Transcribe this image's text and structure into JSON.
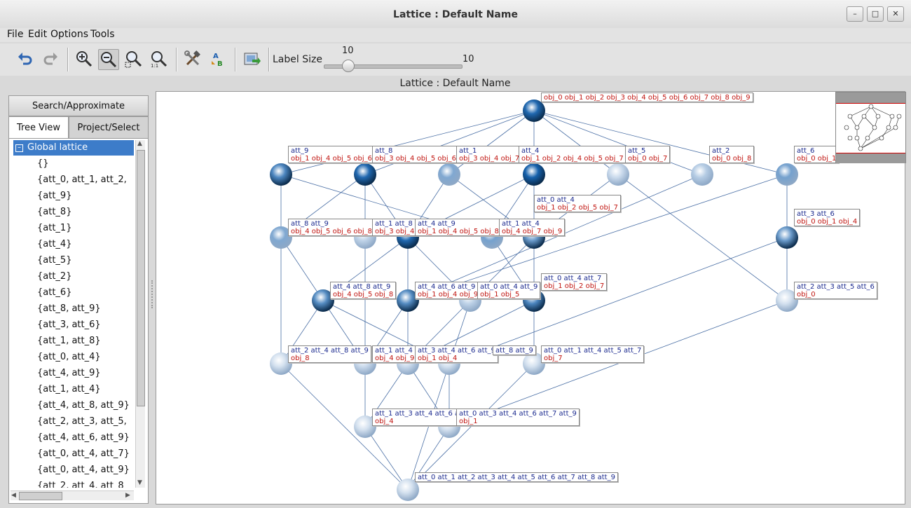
{
  "window": {
    "title": "Lattice : Default Name"
  },
  "menu": [
    "File",
    "Edit",
    "Options",
    "Tools"
  ],
  "toolbar": {
    "icons": [
      "undo-icon",
      "redo-icon",
      "zoom-in-icon",
      "zoom-out-icon",
      "zoom-fit-icon",
      "zoom-reset-icon",
      "settings-tools-icon",
      "label-ab-icon",
      "export-image-icon"
    ],
    "label_size_label": "Label Size",
    "slider_value": "10",
    "slider_max": "10"
  },
  "canvas_caption": "Lattice : Default Name",
  "left_panel": {
    "search_button": "Search/Approximate",
    "tabs": [
      "Tree View",
      "Project/Select"
    ],
    "tree_root": "Global lattice",
    "tree_items": [
      "{}",
      "{att_0, att_1, att_2,",
      "{att_9}",
      "{att_8}",
      "{att_1}",
      "{att_4}",
      "{att_5}",
      "{att_2}",
      "{att_6}",
      "{att_8, att_9}",
      "{att_3, att_6}",
      "{att_1, att_8}",
      "{att_0, att_4}",
      "{att_4, att_9}",
      "{att_1, att_4}",
      "{att_4, att_8, att_9}",
      "{att_2, att_3, att_5,",
      "{att_4, att_6, att_9}",
      "{att_0, att_4, att_7}",
      "{att_0, att_4, att_9}",
      "{att_2, att_4, att_8"
    ]
  },
  "lattice": {
    "colors": {
      "edge": "#4a6fa5",
      "attr_text": "#1b2a8f",
      "obj_text": "#c0140f",
      "node_dark": "#0b5aa8",
      "node_light": "#dfe8f3"
    },
    "labels": [
      {
        "attr": "",
        "obj": "obj_0 obj_1 obj_2 obj_3 obj_4 obj_5 obj_6 obj_7 obj_8 obj_9"
      },
      {
        "attr": "att_9",
        "obj": "obj_1 obj_4 obj_5 obj_6"
      },
      {
        "attr": "att_8",
        "obj": "obj_3 obj_4 obj_5 obj_6"
      },
      {
        "attr": "att_1",
        "obj": "obj_3 obj_4 obj_7"
      },
      {
        "attr": "att_4",
        "obj": "obj_1 obj_2 obj_4 obj_5 obj_7"
      },
      {
        "attr": "att_5",
        "obj": "obj_0 obj_7"
      },
      {
        "attr": "att_2",
        "obj": "obj_0 obj_8"
      },
      {
        "attr": "att_6",
        "obj": "obj_0 obj_1"
      },
      {
        "attr": "att_0 att_4",
        "obj": "obj_1 obj_2 obj_5 obj_7"
      },
      {
        "attr": "att_3 att_6",
        "obj": "obj_0 obj_1 obj_4"
      },
      {
        "attr": "att_8 att_9",
        "obj": "obj_4 obj_5 obj_6 obj_8"
      },
      {
        "attr": "att_1 att_8",
        "obj": "obj_3 obj_4"
      },
      {
        "attr": "att_4 att_9",
        "obj": "obj_1 obj_4 obj_5 obj_8"
      },
      {
        "attr": "att_1 att_4",
        "obj": "obj_4 obj_7 obj_9"
      },
      {
        "attr": "att_0 att_4 att_7",
        "obj": "obj_1 obj_2 obj_7"
      },
      {
        "attr": "att_4 att_8 att_9",
        "obj": "obj_4 obj_5 obj_8"
      },
      {
        "attr": "att_4 att_6 att_9",
        "obj": "obj_1 obj_4 obj_9"
      },
      {
        "attr": "att_0 att_4 att_9",
        "obj": "obj_1 obj_5"
      },
      {
        "attr": "att_2 att_3 att_5 att_6",
        "obj": "obj_0"
      },
      {
        "attr": "att_2 att_4 att_8 att_9",
        "obj": "obj_8"
      },
      {
        "attr": "att_1 att_4",
        "obj": "obj_4 obj_9"
      },
      {
        "attr": "att_3 att_4 att_6 att_9",
        "obj": "obj_1 obj_4"
      },
      {
        "attr": "att_8 att_9",
        "obj": ""
      },
      {
        "attr": "att_0 att_1 att_4 att_5 att_7",
        "obj": "obj_7"
      },
      {
        "attr": "att_1 att_3 att_4 att_6 at",
        "obj": "obj_4"
      },
      {
        "attr": "att_0 att_3 att_4 att_6 att_7 att_9",
        "obj": "obj_1"
      },
      {
        "attr": "att_0 att_1 att_2 att_3 att_4 att_5 att_6 att_7 att_8 att_9",
        "obj": ""
      }
    ]
  }
}
